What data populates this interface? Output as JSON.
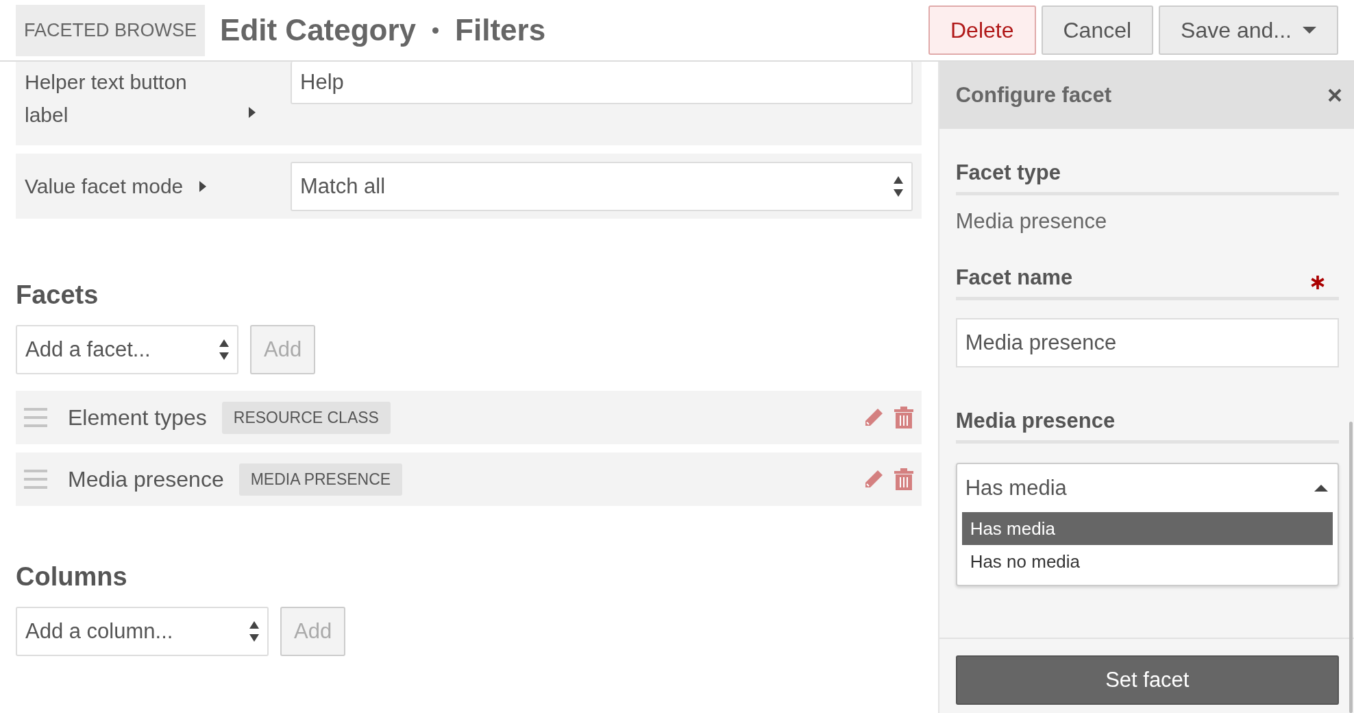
{
  "header": {
    "breadcrumb": "FACETED BROWSE",
    "title": "Edit Category",
    "subtitle": "Filters",
    "buttons": [
      {
        "label": "Delete",
        "kind": "danger"
      },
      {
        "label": "Cancel",
        "kind": "default"
      },
      {
        "label": "Save and...",
        "kind": "dropdown"
      }
    ]
  },
  "settings": [
    {
      "label": "Helper text button label",
      "kind": "text",
      "value": "Help"
    },
    {
      "label": "Value facet mode",
      "kind": "select",
      "value": "Match all"
    }
  ],
  "facets": {
    "heading": "Facets",
    "select": "Add a facet...",
    "add_button": {
      "label": "Add",
      "disabled": true
    },
    "items": [
      {
        "name": "Element types",
        "tag": "RESOURCE CLASS"
      },
      {
        "name": "Media presence",
        "tag": "MEDIA PRESENCE"
      }
    ]
  },
  "columns": {
    "heading": "Columns",
    "select": "Add a column...",
    "add_button": {
      "label": "Add",
      "disabled": true
    }
  },
  "panel": {
    "title": "Configure facet",
    "facet_type": {
      "label": "Facet type",
      "value": "Media presence"
    },
    "facet_name": {
      "label": "Facet name",
      "required": true,
      "value": "Media presence"
    },
    "media_presence": {
      "label": "Media presence",
      "value": "Has media",
      "expanded": true,
      "options": [
        {
          "label": "Has media",
          "selected": true
        },
        {
          "label": "Has no media",
          "selected": false
        }
      ]
    },
    "submit": "Set facet"
  }
}
